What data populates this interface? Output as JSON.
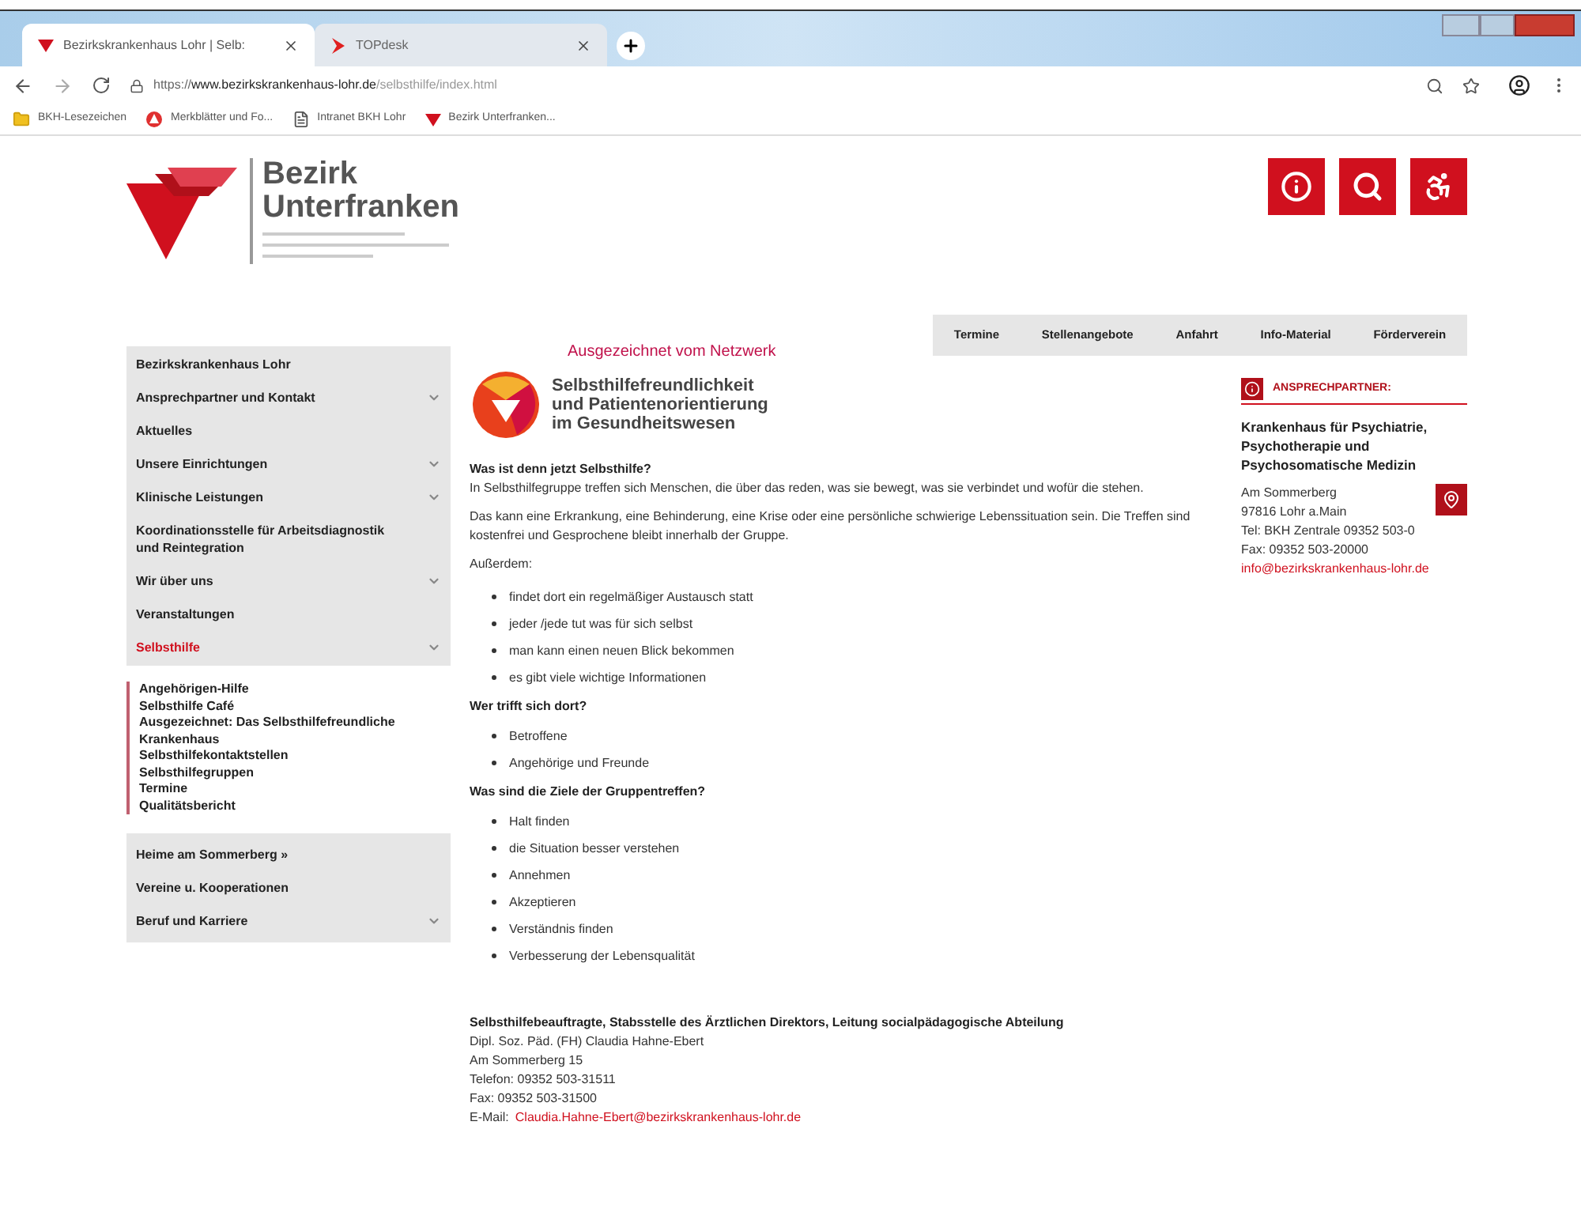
{
  "browser": {
    "tabs": [
      {
        "title": "Bezirkskrankenhaus Lohr | Selb:",
        "selected": true
      },
      {
        "title": "TOPdesk",
        "selected": false
      }
    ],
    "address": {
      "scheme": "https://",
      "domain": "www.bezirkskrankenhaus-lohr.de",
      "path": "/selbsthilfe/index.html"
    },
    "bookmarks": [
      "BKH-Lesezeichen",
      "Merkblätter und Fo...",
      "Intranet BKH Lohr",
      "Bezirk Unterfranken..."
    ]
  },
  "header": {
    "logo_lines": [
      "Bezirk",
      "Unterfranken"
    ],
    "actions": [
      {
        "kind": "info"
      },
      {
        "kind": "search"
      },
      {
        "kind": "accessibility"
      }
    ]
  },
  "top_nav": [
    "Termine",
    "Stellenangebote",
    "Anfahrt",
    "Info-Material",
    "Förderverein"
  ],
  "sidebar": {
    "main": [
      {
        "label": "Bezirkskrankenhaus Lohr",
        "expandable": false,
        "selected": false
      },
      {
        "label": "Ansprechpartner und Kontakt",
        "expandable": true,
        "selected": false
      },
      {
        "label": "Aktuelles",
        "expandable": false,
        "selected": false
      },
      {
        "label": "Unsere Einrichtungen",
        "expandable": true,
        "selected": false
      },
      {
        "label": "Klinische Leistungen",
        "expandable": true,
        "selected": false
      },
      {
        "label": "Koordinationsstelle für Arbeitsdiagnostik und Reintegration",
        "expandable": false,
        "selected": false
      },
      {
        "label": "Wir über uns",
        "expandable": true,
        "selected": false
      },
      {
        "label": "Veranstaltungen",
        "expandable": false,
        "selected": false
      },
      {
        "label": "Selbsthilfe",
        "expandable": true,
        "selected": true
      }
    ],
    "sub": [
      "Angehörigen-Hilfe",
      "Selbsthilfe Café",
      "Ausgezeichnet: Das Selbsthilfefreundliche Krankenhaus",
      "Selbsthilfekontaktstellen",
      "Selbsthilfegruppen",
      "Termine",
      "Qualitätsbericht"
    ],
    "secondary": [
      {
        "label": "Heime am Sommerberg »",
        "expandable": false,
        "selected": false
      },
      {
        "label": "Vereine u. Kooperationen",
        "expandable": false,
        "selected": false
      },
      {
        "label": "Beruf und Karriere",
        "expandable": true,
        "selected": false
      }
    ]
  },
  "award": {
    "caption": "Ausgezeichnet vom Netzwerk",
    "lines": [
      "Selbsthilfefreundlichkeit",
      "und Patientenorientierung",
      "im Gesundheitswesen"
    ]
  },
  "content": [
    {
      "kind": "heading",
      "text": "Was ist denn jetzt Selbsthilfe?"
    },
    {
      "kind": "text",
      "text": "In Selbsthilfegruppe treffen sich Menschen, die über das reden, was sie bewegt, was sie verbindet und wofür die stehen."
    },
    {
      "kind": "para",
      "text": "Das kann eine Erkrankung, eine Behinderung, eine Krise oder eine persönliche schwierige Lebenssituation sein. Die Treffen sind kostenfrei und Gesprochene bleibt innerhalb der Gruppe."
    },
    {
      "kind": "para",
      "text": "Außerdem:"
    },
    {
      "kind": "list",
      "items": [
        "findet dort ein regelmäßiger Austausch statt",
        "jeder /jede tut was für sich selbst",
        "man kann einen neuen Blick bekommen",
        "es gibt viele wichtige Informationen"
      ]
    },
    {
      "kind": "heading",
      "text": "Wer trifft sich dort?"
    },
    {
      "kind": "list",
      "items": [
        "Betroffene",
        "Angehörige und Freunde"
      ]
    },
    {
      "kind": "heading",
      "text": "Was sind die Ziele der Gruppentreffen?"
    },
    {
      "kind": "list",
      "items": [
        "Halt finden",
        "die Situation besser verstehen",
        "Annehmen",
        "Akzeptieren",
        "Verständnis finden",
        "Verbesserung der Lebensqualität"
      ]
    }
  ],
  "contact_block": {
    "title": "Selbsthilfebeauftragte, Stabsstelle des Ärztlichen Direktors, Leitung socialpädagogische Abteilung",
    "lines": [
      "Dipl. Soz. Päd. (FH) Claudia Hahne-Ebert",
      "Am Sommerberg 15",
      "Telefon: 09352 503-31511",
      "Fax: 09352 503-31500"
    ],
    "email_label": "E-Mail:",
    "email": "Claudia.Hahne-Ebert@bezirkskrankenhaus-lohr.de"
  },
  "aside": {
    "heading": "ANSPRECHPARTNER:",
    "org": "Krankenhaus für Psychiatrie, Psychotherapie und Psychosomatische Medizin",
    "lines": [
      "Am Sommerberg",
      "97816 Lohr a.Main",
      "Tel: BKH Zentrale 09352 503-0",
      "Fax: 09352 503-20000"
    ],
    "email": "info@bezirkskrankenhaus-lohr.de"
  }
}
